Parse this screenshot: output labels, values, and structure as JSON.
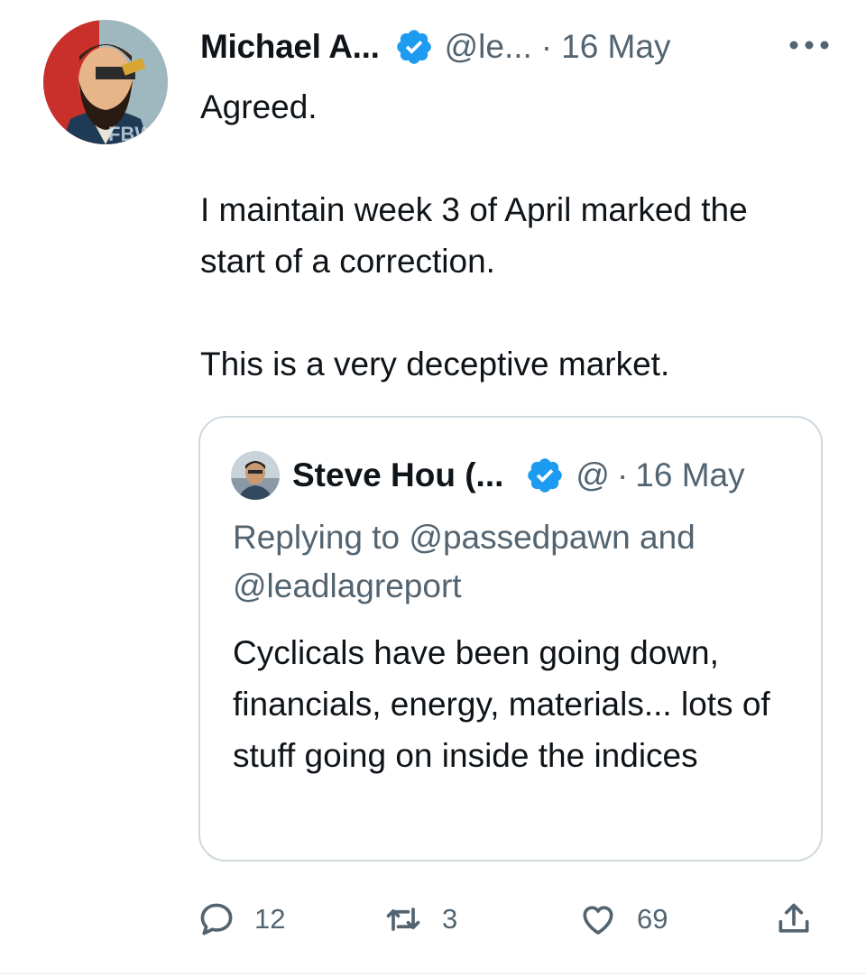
{
  "author": {
    "display_name": "Michael A...",
    "handle": "@le...",
    "separator": "·",
    "timestamp": "16 May",
    "verified": true,
    "avatar_icon": "avatar-image"
  },
  "tweet": {
    "lines": [
      "Agreed.",
      "I maintain week 3 of April marked the start of a correction.",
      "This is a very deceptive market."
    ]
  },
  "quoted_tweet": {
    "display_name": "Steve Hou (...",
    "handle": "@",
    "separator": "·",
    "timestamp": "16 May",
    "verified": true,
    "reply_prefix": "Replying to",
    "reply_to_1": "@passedpawn",
    "reply_conjunction": "and",
    "reply_to_2": "@leadlagreport",
    "body": "Cyclicals have been going down, financials, energy, materials... lots of stuff going on inside the indices"
  },
  "actions": {
    "replies": "12",
    "retweets": "3",
    "likes": "69",
    "reply_icon": "reply-icon",
    "retweet_icon": "retweet-icon",
    "like_icon": "heart-icon",
    "share_icon": "share-icon"
  },
  "colors": {
    "text_primary": "#0f1419",
    "text_secondary": "#536471",
    "verified_blue": "#1d9bf0",
    "border": "#cfd9de"
  }
}
